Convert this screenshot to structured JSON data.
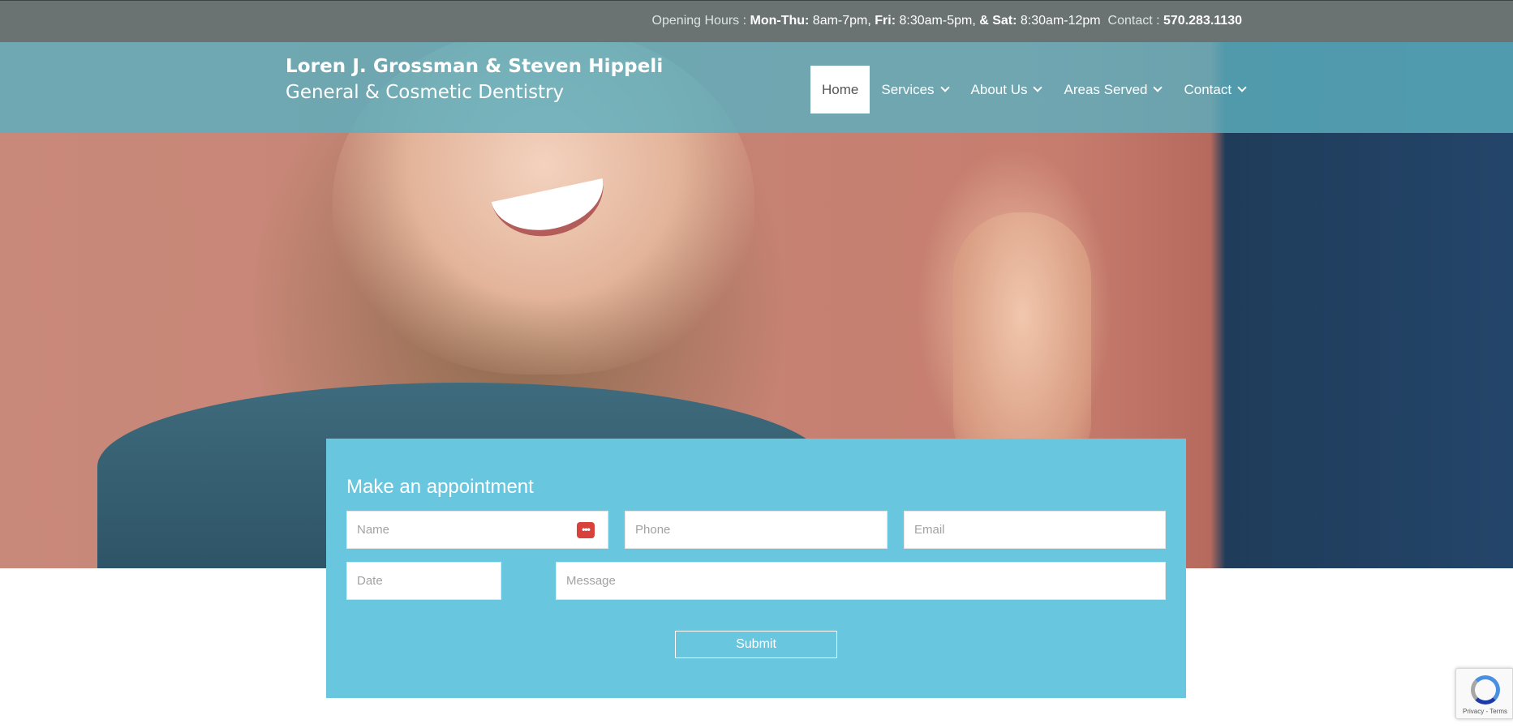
{
  "topbar": {
    "hours_prefix": "Opening Hours : ",
    "mon_thu_label": "Mon-Thu:",
    "mon_thu_hours": " 8am-7pm, ",
    "fri_label": "Fri:",
    "fri_hours": " 8:30am-5pm, ",
    "sat_label": "& Sat:",
    "sat_hours": " 8:30am-12pm",
    "contact_prefix": "Contact : ",
    "phone": "570.283.1130"
  },
  "brand": {
    "line1": "Loren J. Grossman & Steven Hippeli",
    "line2": "General & Cosmetic Dentistry"
  },
  "nav": {
    "items": [
      {
        "label": "Home",
        "active": true,
        "dropdown": false
      },
      {
        "label": "Services",
        "active": false,
        "dropdown": true
      },
      {
        "label": "About Us",
        "active": false,
        "dropdown": true
      },
      {
        "label": "Areas Served",
        "active": false,
        "dropdown": true
      },
      {
        "label": "Contact",
        "active": false,
        "dropdown": true
      }
    ]
  },
  "appointment": {
    "title": "Make an appointment",
    "name_placeholder": "Name",
    "phone_placeholder": "Phone",
    "email_placeholder": "Email",
    "date_placeholder": "Date",
    "message_placeholder": "Message",
    "submit_label": "Submit",
    "password_manager_icon": "•••"
  },
  "recaptcha": {
    "text": "Privacy - Terms"
  },
  "colors": {
    "topbar": "#6b7272",
    "header_overlay": "#5cafbe",
    "form_bg": "#68c6df",
    "nav_active_bg": "#ffffff"
  }
}
